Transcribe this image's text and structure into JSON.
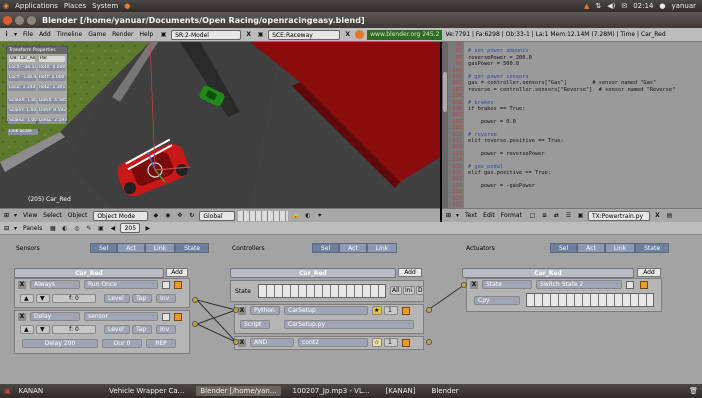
{
  "gnome_panel": {
    "menus": [
      "Applications",
      "Places",
      "System"
    ],
    "time": "02:14",
    "user": "yanuar"
  },
  "window": {
    "title": "Blender [/home/yanuar/Documents/Open Racing/openracingeasy.blend]"
  },
  "blender_header": {
    "menus": [
      "File",
      "Add",
      "Timeline",
      "Game",
      "Render",
      "Help"
    ],
    "screen": "SR:2-Model",
    "scene": "SCE:Raceway",
    "url": "www.blender.org 245.2",
    "stats": "Ve:7791 | Fa:6298 | Ob:33-1 | La:1  Mem:12.14M (7.28M) | Time | Car_Red"
  },
  "transform_panel": {
    "title": "Transform Properties",
    "ob": "OB: Car_Red",
    "par": "Par",
    "fields": [
      "LocX: -34.545",
      "RotX: 0.000",
      "LocY: -138.459",
      "RotY: 0.000",
      "LocZ: 1.244",
      "RotZ: 1.301",
      "ScaleX: 1.000",
      "DimX: 4.585",
      "ScaleY: 1.000",
      "DimY: 9.592",
      "ScaleZ: 1.000",
      "DimZ: 2.597"
    ],
    "link_scale": "Link Scale"
  },
  "viewport": {
    "label": "(205) Car_Red"
  },
  "viewport_header": {
    "menus": [
      "View",
      "Select",
      "Object"
    ],
    "mode": "Object Mode",
    "pivot": "Global"
  },
  "text_editor": {
    "lines": [
      {
        "n": "96",
        "t": "",
        "cls": ""
      },
      {
        "n": "97",
        "t": "# set power amounts",
        "cls": "cm"
      },
      {
        "n": "98",
        "t": "reversePower = 200.0",
        "cls": ""
      },
      {
        "n": "99",
        "t": "gasPower = 500.0",
        "cls": ""
      },
      {
        "n": "100",
        "t": "",
        "cls": ""
      },
      {
        "n": "101",
        "t": "# get power sensors",
        "cls": "cm"
      },
      {
        "n": "102",
        "t": "gas = controller.sensors[\"Gas\"]        # sensor named \"Gas\"",
        "cls": ""
      },
      {
        "n": "103",
        "t": "reverse = controller.sensors[\"Reverse\"]  # sensor named \"Reverse\"",
        "cls": ""
      },
      {
        "n": "104",
        "t": "",
        "cls": ""
      },
      {
        "n": "105",
        "t": "# brakes",
        "cls": "cm"
      },
      {
        "n": "106",
        "t": "if brakes == True:",
        "cls": ""
      },
      {
        "n": "107",
        "t": "",
        "cls": ""
      },
      {
        "n": "108",
        "t": "    power = 0.0",
        "cls": ""
      },
      {
        "n": "109",
        "t": "",
        "cls": ""
      },
      {
        "n": "110",
        "t": "# reverse",
        "cls": "cm"
      },
      {
        "n": "111",
        "t": "elif reverse.positive == True:",
        "cls": ""
      },
      {
        "n": "112",
        "t": "",
        "cls": ""
      },
      {
        "n": "113",
        "t": "    power = reversePower",
        "cls": ""
      },
      {
        "n": "114",
        "t": "",
        "cls": ""
      },
      {
        "n": "115",
        "t": "# gas pedal",
        "cls": "cm"
      },
      {
        "n": "116",
        "t": "elif gas.positive == True:",
        "cls": ""
      },
      {
        "n": "117",
        "t": "",
        "cls": ""
      },
      {
        "n": "118",
        "t": "    power = -gasPower",
        "cls": ""
      },
      {
        "n": "119",
        "t": "",
        "cls": ""
      },
      {
        "n": "120",
        "t": "",
        "cls": ""
      },
      {
        "n": "121",
        "t": "",
        "cls": ""
      }
    ]
  },
  "text_header": {
    "menus": [
      "Text",
      "Edit",
      "Format"
    ],
    "file": "TX:Powertrain.py"
  },
  "logic_header": {
    "panels": "Panels",
    "frame": "205"
  },
  "sensors": {
    "title": "Sensors",
    "tabs": [
      "Sel",
      "Act",
      "Link",
      "State"
    ],
    "object": "Car_Red",
    "add": "Add",
    "always": {
      "type": "Always",
      "name": "Run Once",
      "f": "f: 0",
      "level": "Level",
      "tap": "Tap",
      "inv": "Inv"
    },
    "delay": {
      "type": "Delay",
      "name": "sensor",
      "delay": "Delay 200",
      "dur": "Dur 0",
      "rep": "REP"
    }
  },
  "controllers": {
    "title": "Controllers",
    "tabs": [
      "Sel",
      "Act",
      "Link"
    ],
    "object": "Car_Red",
    "add": "Add",
    "state": "State",
    "all": "All",
    "ini": "Ini",
    "d": "D",
    "python": {
      "type": "Python",
      "name": "CarSetup",
      "prio": "1",
      "mode": "Script",
      "script": "CarSetup.py"
    },
    "and": {
      "type": "AND",
      "name": "cont2",
      "prio": "1"
    }
  },
  "actuators": {
    "title": "Actuators",
    "tabs": [
      "Sel",
      "Act",
      "Link",
      "State"
    ],
    "object": "Car_Red",
    "add": "Add",
    "state": {
      "type": "State",
      "name": "Switch State 2",
      "op": "Cpy"
    }
  },
  "taskbar": {
    "items": [
      "KANAN",
      "Vehicle Wrapper Ca...",
      "Blender [/home/yan...",
      "100207_Jp.mp3 - VL...",
      "[KANAN]",
      "Blender"
    ]
  }
}
